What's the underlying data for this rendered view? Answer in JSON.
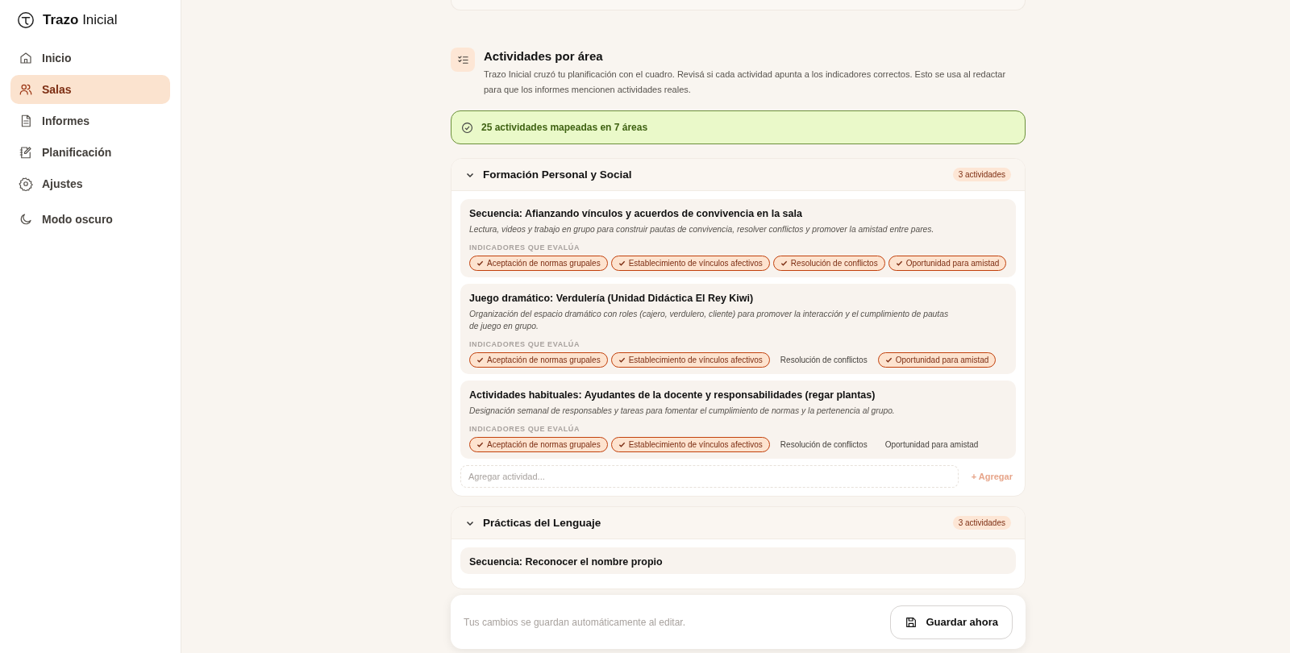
{
  "app": {
    "brand_bold": "Trazo",
    "brand_rest": "Inicial"
  },
  "sidebar": {
    "items": [
      {
        "label": "Inicio",
        "kind": "link",
        "selected": false
      },
      {
        "label": "Salas",
        "kind": "link",
        "selected": true
      },
      {
        "label": "Informes",
        "kind": "link",
        "selected": false
      },
      {
        "label": "Planificación",
        "kind": "link",
        "selected": false
      },
      {
        "label": "Ajustes",
        "kind": "link",
        "selected": false
      },
      {
        "label": "Modo oscuro",
        "kind": "toggle",
        "selected": false
      }
    ]
  },
  "section": {
    "title": "Actividades por área",
    "description": "Trazo Inicial cruzó tu planificación con el cuadro. Revisá si cada actividad apunta a los indicadores correctos. Esto se usa al redactar para que los informes mencionen actividades reales.",
    "summary": "25 actividades mapeadas en 7 áreas"
  },
  "areas": [
    {
      "name": "Formación Personal y Social",
      "count": "3 actividades",
      "expanded": true,
      "add_placeholder": "Agregar actividad...",
      "add_button": "+ Agregar",
      "activities": [
        {
          "title": "Secuencia: Afianzando vínculos y acuerdos de convivencia en la sala",
          "description": "Lectura, videos y trabajo en grupo para construir pautas de convivencia, resolver conflictos y promover la amistad entre pares.",
          "indicators_label": "INDICADORES QUE EVALÚA",
          "indicators": [
            {
              "label": "Aceptación de normas grupales",
              "checked": true
            },
            {
              "label": "Establecimiento de vínculos afectivos",
              "checked": true
            },
            {
              "label": "Resolución de conflictos",
              "checked": true
            },
            {
              "label": "Oportunidad para amistad",
              "checked": true
            }
          ]
        },
        {
          "title": "Juego dramático: Verdulería (Unidad Didáctica El Rey Kiwi)",
          "description": "Organización del espacio dramático con roles (cajero, verdulero, cliente) para promover la interacción y el cumplimiento de pautas de juego en grupo.",
          "indicators_label": "INDICADORES QUE EVALÚA",
          "indicators": [
            {
              "label": "Aceptación de normas grupales",
              "checked": true
            },
            {
              "label": "Establecimiento de vínculos afectivos",
              "checked": true
            },
            {
              "label": "Resolución de conflictos",
              "checked": false
            },
            {
              "label": "Oportunidad para amistad",
              "checked": true
            }
          ]
        },
        {
          "title": "Actividades habituales: Ayudantes de la docente y responsabilidades (regar plantas)",
          "description": "Designación semanal de responsables y tareas para fomentar el cumplimiento de normas y la pertenencia al grupo.",
          "indicators_label": "INDICADORES QUE EVALÚA",
          "indicators": [
            {
              "label": "Aceptación de normas grupales",
              "checked": true
            },
            {
              "label": "Establecimiento de vínculos afectivos",
              "checked": true
            },
            {
              "label": "Resolución de conflictos",
              "checked": false
            },
            {
              "label": "Oportunidad para amistad",
              "checked": false
            }
          ]
        }
      ]
    },
    {
      "name": "Prácticas del Lenguaje",
      "count": "3 actividades",
      "expanded": true,
      "activities": [
        {
          "title": "Secuencia: Reconocer el nombre propio"
        }
      ]
    }
  ],
  "save_bar": {
    "note": "Tus cambios se guardan automáticamente al editar.",
    "button": "Guardar ahora"
  }
}
